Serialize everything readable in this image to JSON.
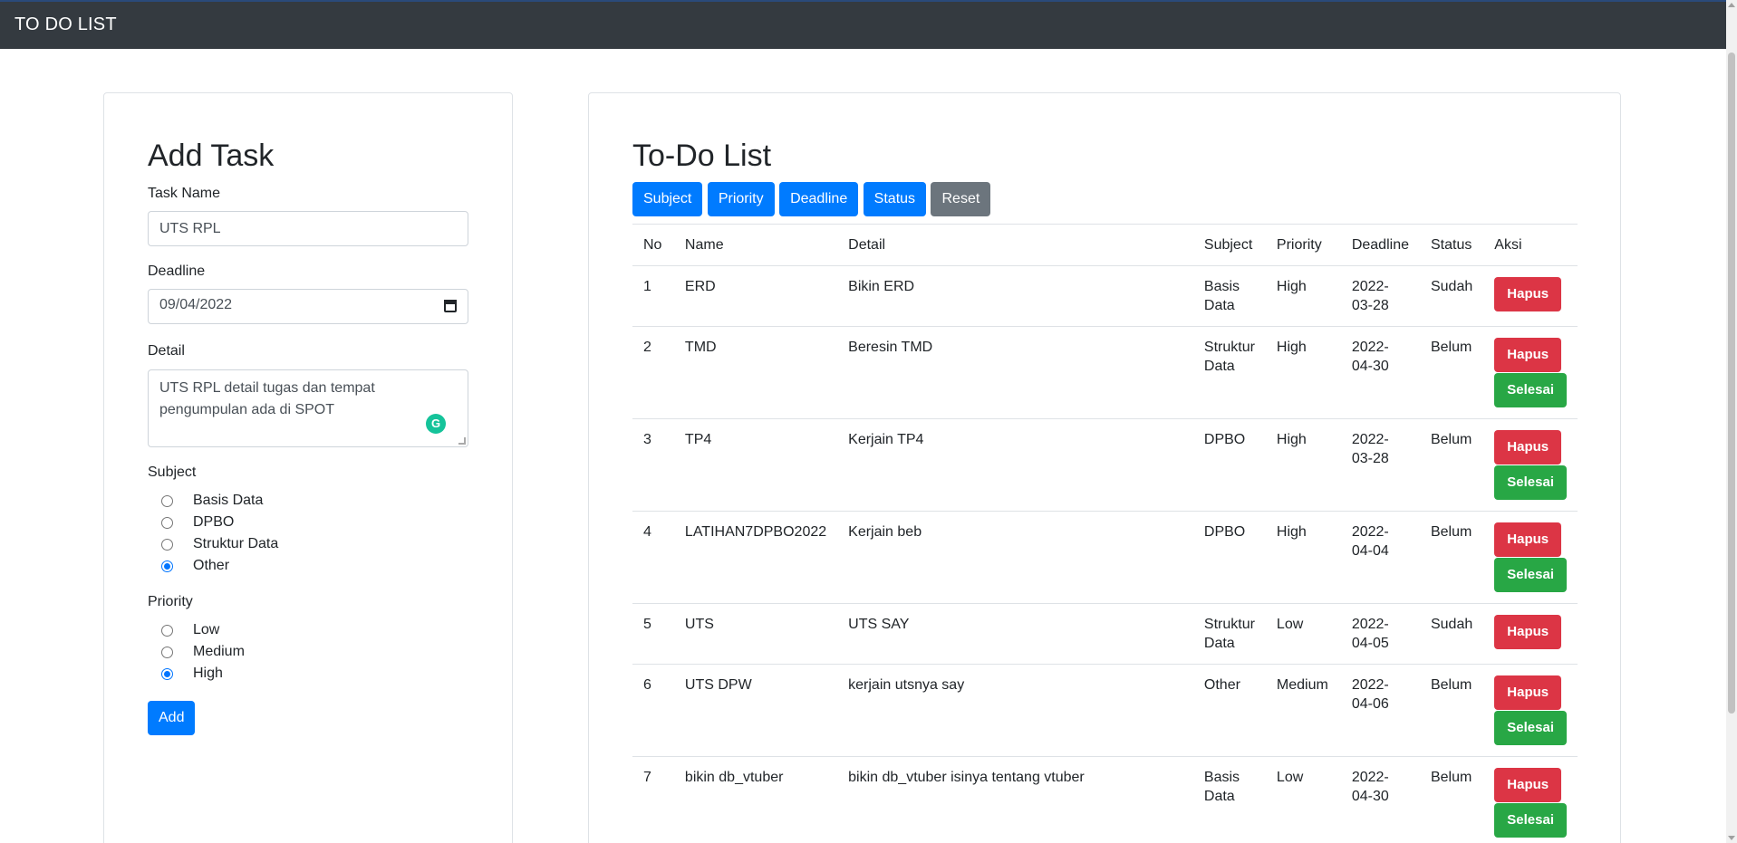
{
  "navbar": {
    "brand": "TO DO LIST"
  },
  "add_task": {
    "title": "Add Task",
    "task_name_label": "Task Name",
    "task_name_value": "UTS RPL",
    "deadline_label": "Deadline",
    "deadline_value": "09/04/2022",
    "detail_label": "Detail",
    "detail_value": "UTS RPL detail tugas dan tempat pengumpulan ada di SPOT",
    "subject_label": "Subject",
    "subject_options": [
      "Basis Data",
      "DPBO",
      "Struktur Data",
      "Other"
    ],
    "subject_selected": "Other",
    "priority_label": "Priority",
    "priority_options": [
      "Low",
      "Medium",
      "High"
    ],
    "priority_selected": "High",
    "add_button": "Add"
  },
  "todo": {
    "title": "To-Do List",
    "filters": [
      "Subject",
      "Priority",
      "Deadline",
      "Status",
      "Reset"
    ],
    "columns": [
      "No",
      "Name",
      "Detail",
      "Subject",
      "Priority",
      "Deadline",
      "Status",
      "Aksi"
    ],
    "rows": [
      {
        "no": "1",
        "name": "ERD",
        "detail": "Bikin ERD",
        "subject": "Basis Data",
        "priority": "High",
        "deadline": "2022-03-28",
        "status": "Sudah"
      },
      {
        "no": "2",
        "name": "TMD",
        "detail": "Beresin TMD",
        "subject": "Struktur Data",
        "priority": "High",
        "deadline": "2022-04-30",
        "status": "Belum"
      },
      {
        "no": "3",
        "name": "TP4",
        "detail": "Kerjain TP4",
        "subject": "DPBO",
        "priority": "High",
        "deadline": "2022-03-28",
        "status": "Belum"
      },
      {
        "no": "4",
        "name": "LATIHAN7DPBO2022",
        "detail": "Kerjain beb",
        "subject": "DPBO",
        "priority": "High",
        "deadline": "2022-04-04",
        "status": "Belum"
      },
      {
        "no": "5",
        "name": "UTS",
        "detail": "UTS SAY",
        "subject": "Struktur Data",
        "priority": "Low",
        "deadline": "2022-04-05",
        "status": "Sudah"
      },
      {
        "no": "6",
        "name": "UTS DPW",
        "detail": "kerjain utsnya say",
        "subject": "Other",
        "priority": "Medium",
        "deadline": "2022-04-06",
        "status": "Belum"
      },
      {
        "no": "7",
        "name": "bikin db_vtuber",
        "detail": "bikin db_vtuber isinya tentang vtuber",
        "subject": "Basis Data",
        "priority": "Low",
        "deadline": "2022-04-30",
        "status": "Belum"
      }
    ],
    "delete_label": "Hapus",
    "done_label": "Selesai"
  },
  "colors": {
    "navbar": "#343a40",
    "primary": "#007bff",
    "secondary": "#6c757d",
    "danger": "#dc3545",
    "success": "#28a745"
  },
  "icons": [
    "calendar-icon",
    "grammarly-icon"
  ]
}
